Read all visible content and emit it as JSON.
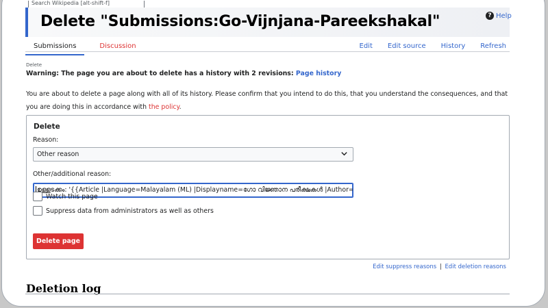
{
  "tooltip": "Search Wikipedia [alt-shift-f]",
  "page": {
    "title": "Delete \"Submissions:Go-Vijnjana-Pareekshakal\"",
    "help_label": "Help"
  },
  "tabs": {
    "left": [
      {
        "label": "Submissions",
        "active": true
      },
      {
        "label": "Discussion",
        "active": false
      }
    ],
    "right": [
      {
        "label": "Edit"
      },
      {
        "label": "Edit source"
      },
      {
        "label": "History"
      },
      {
        "label": "Refresh"
      }
    ]
  },
  "content": {
    "subtitle": "Delete",
    "warning_text": "Warning: The page you are about to delete has a history with 2 revisions:",
    "warning_link": "Page history",
    "intro_text": "You are about to delete a page along with all of its history. Please confirm that you intend to do this, that you understand the consequences, and that you are doing this in accordance with",
    "intro_link": "the policy",
    "intro_end": "."
  },
  "form": {
    "legend": "Delete",
    "reason_label": "Reason:",
    "reason_selected": "Other reason",
    "other_label": "Other/additional reason:",
    "other_value": "ഉള്ളടക്കം: '{{Article |Language=Malayalam (ML) |Displayname=ഗോ വിജ്ഞാന പരീക്ഷകൾ |Author=Au",
    "watch_label": "Watch this page",
    "suppress_label": "Suppress data from administrators as well as others",
    "submit_label": "Delete page"
  },
  "footer_links": {
    "suppress": "Edit suppress reasons",
    "separator": "|",
    "deletion": "Edit deletion reasons"
  },
  "deletion_log_heading": "Deletion log"
}
